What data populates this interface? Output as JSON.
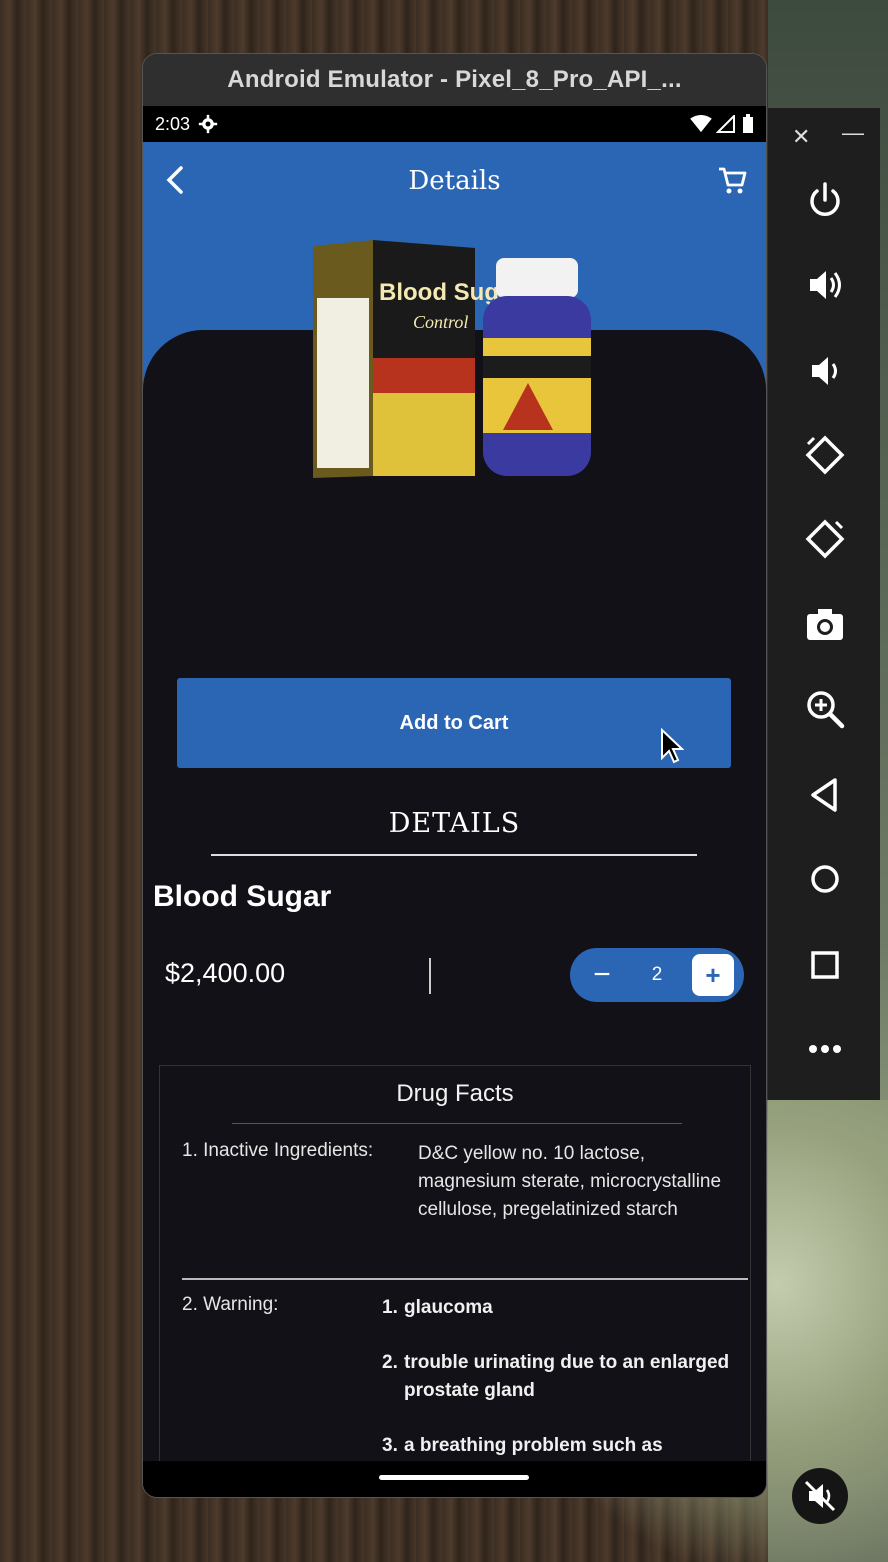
{
  "window": {
    "title": "Android Emulator - Pixel_8_Pro_API_..."
  },
  "status_bar": {
    "time": "2:03"
  },
  "app_bar": {
    "title": "Details"
  },
  "product_image": {
    "brand_text": "Blood Sugar",
    "sub_text": "Control"
  },
  "add_to_cart": {
    "label": "Add to Cart"
  },
  "details": {
    "heading": "DETAILS",
    "product_name": "Blood Sugar",
    "price": "$2,400.00",
    "quantity": "2",
    "minus": "−",
    "plus": "+"
  },
  "drug_facts": {
    "title": "Drug Facts",
    "rows": [
      {
        "label": "1. Inactive Ingredients:",
        "value": "D&C yellow no. 10 lactose, magnesium sterate, microcrystalline cellulose, pregelatinized starch"
      },
      {
        "label": "2. Warning:",
        "items": [
          {
            "num": "1.",
            "text": "glaucoma"
          },
          {
            "num": "2.",
            "text": "trouble urinating due to an enlarged prostate gland"
          },
          {
            "num": "3.",
            "text": "a breathing problem such as"
          }
        ]
      }
    ]
  },
  "colors": {
    "primary": "#2b66b5",
    "background": "#111117"
  }
}
